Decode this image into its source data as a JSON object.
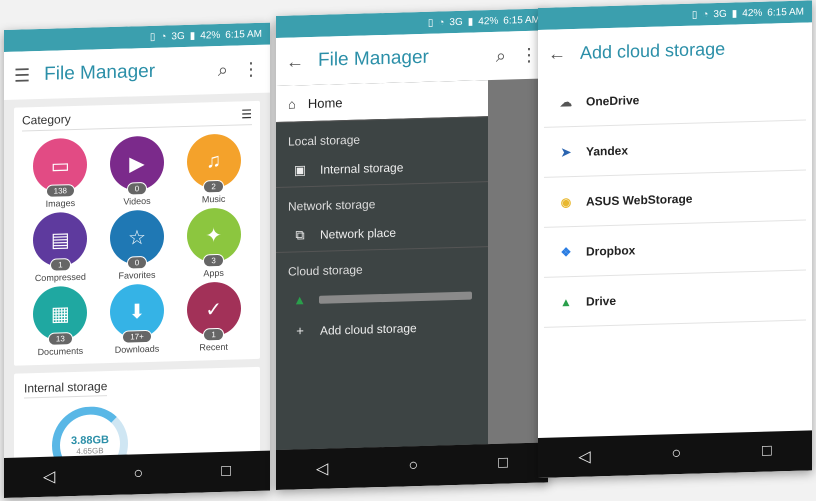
{
  "status": {
    "battery": "42%",
    "time": "6:15 AM",
    "network": "3G"
  },
  "screen1": {
    "title": "File Manager",
    "category_header": "Category",
    "categories": [
      {
        "label": "Images",
        "count": "138",
        "color": "#e24b84",
        "icon": "image-icon",
        "glyph": "▭"
      },
      {
        "label": "Videos",
        "count": "0",
        "color": "#7b2a8b",
        "icon": "video-icon",
        "glyph": "▶"
      },
      {
        "label": "Music",
        "count": "2",
        "color": "#f4a22b",
        "icon": "music-icon",
        "glyph": "♫"
      },
      {
        "label": "Compressed",
        "count": "1",
        "color": "#5e3a9e",
        "icon": "archive-icon",
        "glyph": "▤"
      },
      {
        "label": "Favorites",
        "count": "0",
        "color": "#1f78b4",
        "icon": "star-icon",
        "glyph": "☆"
      },
      {
        "label": "Apps",
        "count": "3",
        "color": "#8cc63f",
        "icon": "android-icon",
        "glyph": "✦"
      },
      {
        "label": "Documents",
        "count": "13",
        "color": "#1fa8a1",
        "icon": "document-icon",
        "glyph": "▦"
      },
      {
        "label": "Downloads",
        "count": "17+",
        "color": "#35b3e6",
        "icon": "download-icon",
        "glyph": "⬇"
      },
      {
        "label": "Recent",
        "count": "1",
        "color": "#a23158",
        "icon": "clock-icon",
        "glyph": "✓"
      }
    ],
    "storage_title": "Internal storage",
    "storage_used": "3.88GB",
    "storage_total": "4.65GB"
  },
  "screen2": {
    "title": "File Manager",
    "home": "Home",
    "local_header": "Local storage",
    "internal": "Internal storage",
    "network_header": "Network storage",
    "network_place": "Network place",
    "cloud_header": "Cloud storage",
    "add_cloud": "Add cloud storage"
  },
  "screen3": {
    "title": "Add cloud storage",
    "providers": [
      {
        "name": "OneDrive",
        "icon": "onedrive-icon",
        "glyph": "☁",
        "color": "#555"
      },
      {
        "name": "Yandex",
        "icon": "yandex-icon",
        "glyph": "➤",
        "color": "#2a64b0"
      },
      {
        "name": "ASUS WebStorage",
        "icon": "asus-webstorage-icon",
        "glyph": "◉",
        "color": "#e8b830"
      },
      {
        "name": "Dropbox",
        "icon": "dropbox-icon",
        "glyph": "❖",
        "color": "#2b7de2"
      },
      {
        "name": "Drive",
        "icon": "google-drive-icon",
        "glyph": "▲",
        "color": "#2a9f4b"
      }
    ]
  }
}
